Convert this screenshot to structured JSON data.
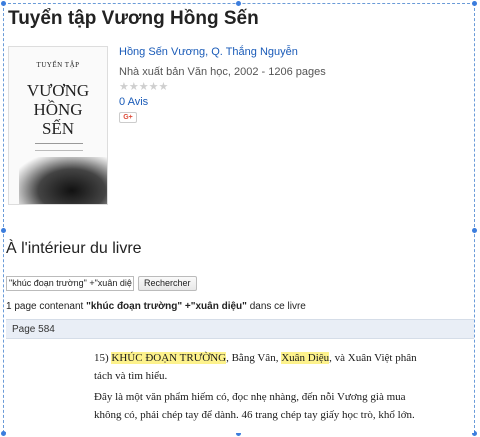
{
  "book": {
    "title": "Tuyển tập Vương Hồng Sến",
    "authors": "Hồng Sến Vương, Q. Thắng Nguyễn",
    "publisher_line": "Nhà xuất bản Văn học, 2002 - 1206 pages",
    "rating_stars": "★★★★★",
    "reviews_label": "0 Avis",
    "gplus_label": "G+",
    "cover": {
      "series": "TUYỂN TẬP",
      "line1": "VƯƠNG",
      "line2": "HỒNG",
      "line3": "SẾN"
    }
  },
  "inside": {
    "heading": "À l'intérieur du livre",
    "search_value": "\"khúc đoạn trường\" +\"xuân diệ",
    "search_button": "Rechercher",
    "result_prefix": "1 page contenant ",
    "result_query": "\"khúc đoạn trường\" +\"xuân diệu\"",
    "result_suffix": " dans ce livre"
  },
  "snippet": {
    "page_label": "Page 584",
    "line1_num": "15) ",
    "line1_hl1": "KHÚC ĐOẠN TRƯỜNG",
    "line1_mid": ", Bằng Vân, ",
    "line1_hl2": "Xuân Diệu",
    "line1_end": ", và Xuân Việt phân",
    "line2": "tách và tìm hiểu.",
    "line3": "Đây là một  văn phẩm hiếm có, đọc nhẹ nhàng, đến nỗi Vương già mua",
    "line4": "không có, phải chép tay để dành.  46 trang chép tay giấy học trò, khổ lớn."
  },
  "colors": {
    "link": "#1a5bb8",
    "highlight": "#fdf28c",
    "page_bar": "#e9eef6",
    "selection": "#3b7ddd"
  }
}
